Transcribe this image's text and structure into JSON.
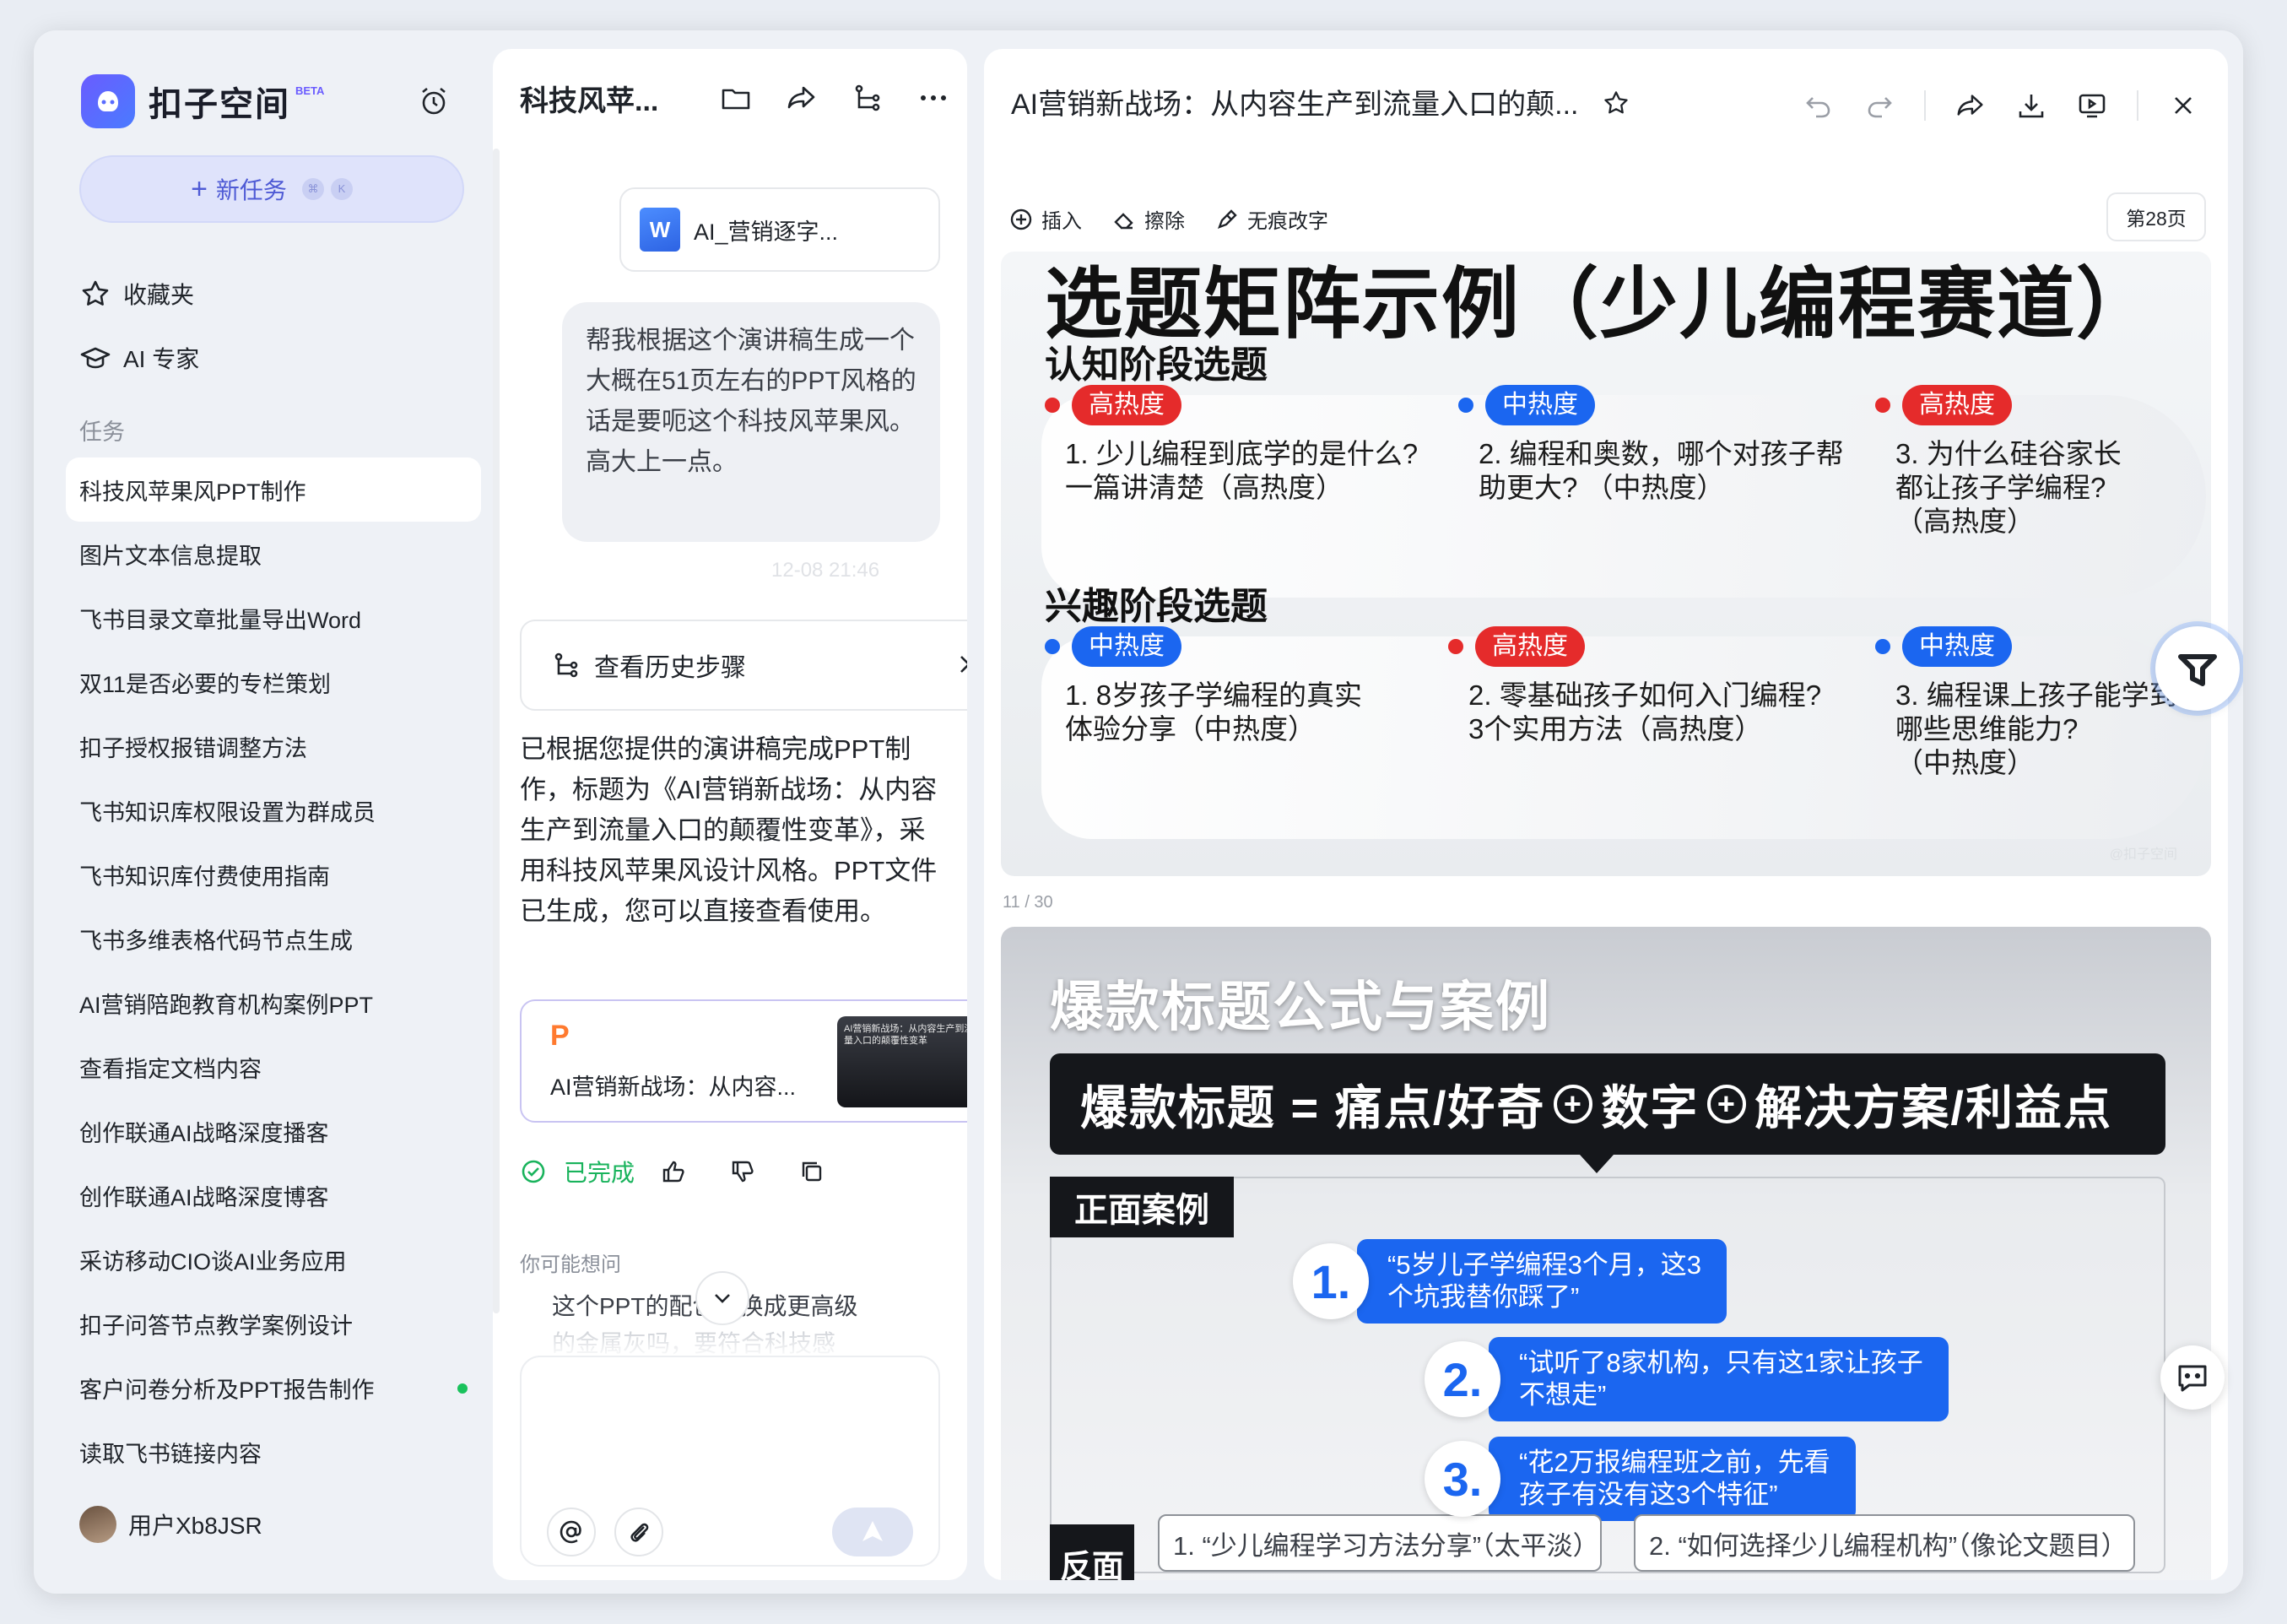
{
  "app": {
    "name": "扣子空间",
    "beta": "BETA",
    "new_task": "新任务",
    "kbd_1": "⌘",
    "kbd_2": "K",
    "favorites": "收藏夹",
    "ai_expert": "AI 专家",
    "tasks_label": "任务",
    "user": "用户Xb8JSR"
  },
  "tasks": [
    "科技风苹果风PPT制作",
    "图片文本信息提取",
    "飞书目录文章批量导出Word",
    "双11是否必要的专栏策划",
    "扣子授权报错调整方法",
    "飞书知识库权限设置为群成员",
    "飞书知识库付费使用指南",
    "飞书多维表格代码节点生成",
    "AI营销陪跑教育机构案例PPT",
    "查看指定文档内容",
    "创作联通AI战略深度播客",
    "创作联通AI战略深度博客",
    "采访移动CIO谈AI业务应用",
    "扣子问答节点教学案例设计",
    "客户问卷分析及PPT报告制作",
    "读取飞书链接内容"
  ],
  "chat": {
    "title": "科技风苹...",
    "file_name": "AI_营销逐字...",
    "file_icon_letter": "W",
    "user_message": "帮我根据这个演讲稿生成一个大概在51页左右的PPT风格的话是要呃这个科技风苹果风。高大上一点。",
    "timestamp": "12-08 21:46",
    "history_button": "查看历史步骤",
    "reply": "已根据您提供的演讲稿完成PPT制作，标题为《AI营销新战场：从内容生产到流量入口的颠覆性变革》，采用科技风苹果风设计风格。PPT文件已生成，您可以直接查看使用。",
    "ppt_letter": "P",
    "ppt_card_title": "AI营销新战场：从内容...",
    "ppt_thumb_text": "AI营销新战场：从内容生产到流量入口的颠覆性变革",
    "status_done": "已完成",
    "maybe_ask": "你可能想问",
    "suggestion_visible": "这个PPT的配色能换成更高级",
    "suggestion_faded": "的金属灰吗，要符合科技感"
  },
  "preview": {
    "title": "AI营销新战场：从内容生产到流量入口的颠...",
    "toolbar": {
      "insert": "插入",
      "erase": "擦除",
      "no_trace_edit": "无痕改字"
    },
    "page": "第28页",
    "slide1": {
      "title": "选题矩阵示例（少儿编程赛道）",
      "section1": "认知阶段选题",
      "section2": "兴趣阶段选题",
      "watermark": "@扣子空间",
      "row1": [
        {
          "heat": "高热度",
          "color": "red",
          "text": "1. 少儿编程到底学的是什么?\n一篇讲清楚（高热度）"
        },
        {
          "heat": "中热度",
          "color": "blue",
          "text": "2. 编程和奥数，哪个对孩子帮\n助更大? （中热度）"
        },
        {
          "heat": "高热度",
          "color": "red",
          "text": "3. 为什么硅谷家长\n都让孩子学编程?\n（高热度）"
        }
      ],
      "row2": [
        {
          "heat": "中热度",
          "color": "blue",
          "text": "1. 8岁孩子学编程的真实\n体验分享（中热度）"
        },
        {
          "heat": "高热度",
          "color": "red",
          "text": "2. 零基础孩子如何入门编程?\n3个实用方法（高热度）"
        },
        {
          "heat": "中热度",
          "color": "blue",
          "text": "3. 编程课上孩子能学到\n哪些思维能力?\n（中热度）"
        }
      ]
    },
    "slide2": {
      "counter": "11 / 30",
      "title": "爆款标题公式与案例",
      "formula_a": "爆款标题 = 痛点/好奇",
      "formula_b": "数字",
      "formula_c": "解决方案/利益点",
      "plus": "+",
      "positive_label": "正面案例",
      "negative_label": "反面",
      "cases": [
        {
          "num": "1.",
          "text": "“5岁儿子学编程3个月，这3\n个坑我替你踩了”"
        },
        {
          "num": "2.",
          "text": "“试听了8家机构，只有这1家让孩子\n不想走”"
        },
        {
          "num": "3.",
          "text": "“花2万报编程班之前，先看\n孩子有没有这3个特征”"
        }
      ],
      "negatives": [
        "1. “少儿编程学习方法分享”（太平淡）",
        "2. “如何选择少儿编程机构”（像论文题目）"
      ]
    }
  },
  "colors": {
    "accent": "#4f5bd5",
    "hot": "#e52b2b",
    "warm": "#1b66f0",
    "done": "#19b35c"
  }
}
